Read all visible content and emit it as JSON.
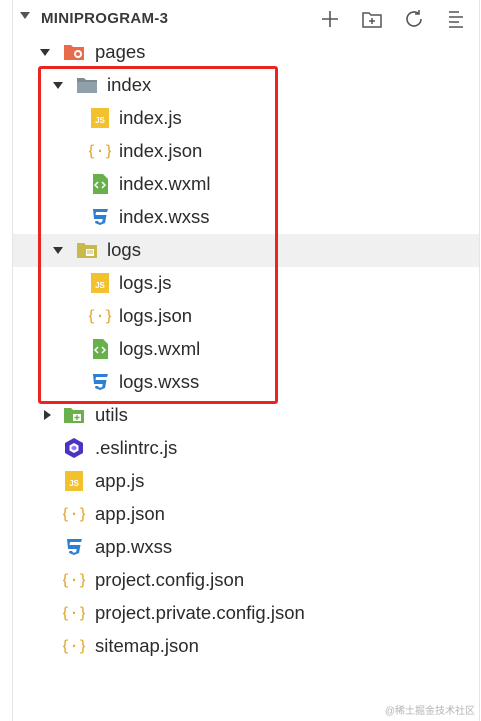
{
  "explorer": {
    "title": "MINIPROGRAM-3",
    "toolbar": {
      "new_file_icon": "plus-icon",
      "new_folder_icon": "new-folder-icon",
      "refresh_icon": "refresh-icon",
      "collapse_icon": "collapse-all-icon"
    }
  },
  "tree": {
    "pages": {
      "label": "pages",
      "icon": "pages-folder-icon"
    },
    "index": {
      "label": "index",
      "icon": "folder-icon"
    },
    "index_js": {
      "label": "index.js",
      "icon": "js-file-icon"
    },
    "index_json": {
      "label": "index.json",
      "icon": "json-file-icon"
    },
    "index_wxml": {
      "label": "index.wxml",
      "icon": "wxml-file-icon"
    },
    "index_wxss": {
      "label": "index.wxss",
      "icon": "wxss-file-icon"
    },
    "logs": {
      "label": "logs",
      "icon": "logs-folder-icon"
    },
    "logs_js": {
      "label": "logs.js",
      "icon": "js-file-icon"
    },
    "logs_json": {
      "label": "logs.json",
      "icon": "json-file-icon"
    },
    "logs_wxml": {
      "label": "logs.wxml",
      "icon": "wxml-file-icon"
    },
    "logs_wxss": {
      "label": "logs.wxss",
      "icon": "wxss-file-icon"
    },
    "utils": {
      "label": "utils",
      "icon": "utils-folder-icon"
    },
    "eslintrc": {
      "label": ".eslintrc.js",
      "icon": "eslint-icon"
    },
    "app_js": {
      "label": "app.js",
      "icon": "js-file-icon"
    },
    "app_json": {
      "label": "app.json",
      "icon": "json-file-icon"
    },
    "app_wxss": {
      "label": "app.wxss",
      "icon": "wxss-file-icon"
    },
    "project_config": {
      "label": "project.config.json",
      "icon": "json-file-icon"
    },
    "project_private": {
      "label": "project.private.config.json",
      "icon": "json-file-icon"
    },
    "sitemap": {
      "label": "sitemap.json",
      "icon": "json-file-icon"
    }
  },
  "highlight_color": "#e8261f",
  "watermark": "@稀土掘金技术社区"
}
